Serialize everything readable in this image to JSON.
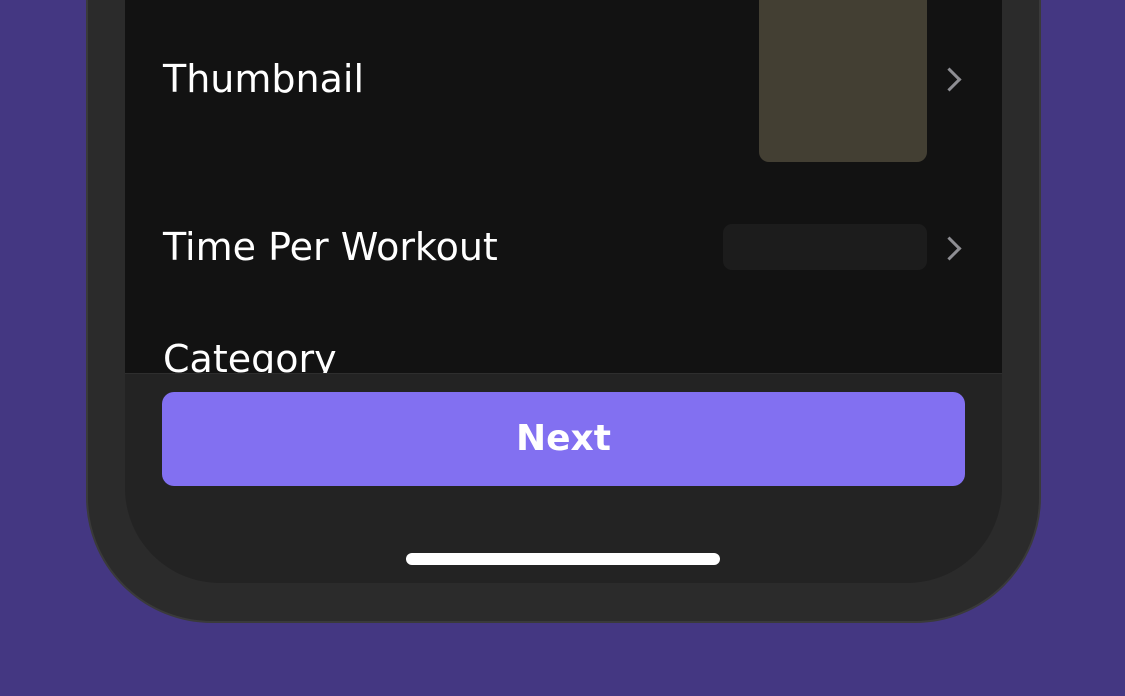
{
  "form": {
    "thumbnail_label": "Thumbnail",
    "time_per_workout_label": "Time Per Workout",
    "category_label": "Category"
  },
  "footer": {
    "next_label": "Next"
  },
  "colors": {
    "background": "#443782",
    "accent": "#8270f1",
    "screen": "#121212",
    "thumbnail_placeholder": "#433f33"
  }
}
